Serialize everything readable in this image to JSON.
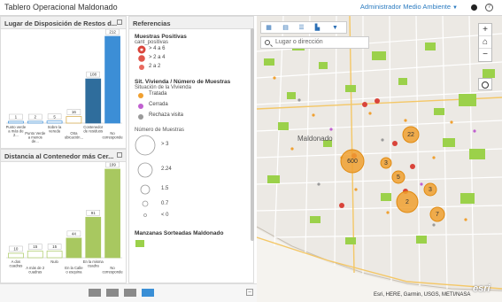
{
  "app": {
    "title": "Tablero Operacional Maldonado",
    "user": "Administrador Medio Ambiente"
  },
  "panel_lugar": {
    "title": "Lugar de Disposición de Restos d..."
  },
  "panel_distancia": {
    "title": "Distancia al Contenedor más Cer..."
  },
  "panel_ref": {
    "title": "Referencias",
    "muestras_title": "Muestras Positivas",
    "muestras_field": "cant_positivas",
    "muestras_items": [
      "> 4 a 6",
      "> 2 a 4",
      "2 a 2"
    ],
    "vivienda_title": "Sit. Vivienda / Número de Muestras",
    "vivienda_sub": "Situación de la Vivienda",
    "vivienda_items": [
      "Tratada",
      "Cerrada",
      "Rechaza visita"
    ],
    "numero_title": "Número de Muestras",
    "numero_items": [
      "> 3",
      "2.24",
      "1.5",
      "0.7",
      "< 0"
    ],
    "manzanas_title": "Manzanas Sorteadas Maldonado"
  },
  "map": {
    "search_placeholder": "Lugar o dirección",
    "attribution": "Esri, HERE, Garmin, USGS, METI/NASA",
    "logo": "esri",
    "city_label": "Maldonado",
    "cluster_labels": [
      "600",
      "22",
      "5",
      "2",
      "3",
      "7",
      "3"
    ]
  },
  "colors": {
    "bar_lugar": [
      "#3c8ed6",
      "#3c8ed6",
      "#3c8ed6",
      "#d4a640",
      "#2f6d9c",
      "#3c8ed6"
    ],
    "bar_distancia": "#a8c860",
    "accent": "#3a8fd6",
    "cluster": "#f0a030",
    "green_area": "#9bd14a"
  },
  "chart_data": [
    {
      "type": "bar",
      "categories": [
        "Punto verde a más de 2...",
        "Punto Verde a menos de...",
        "Sobre la vereda",
        "Otra ubicación...",
        "Contenedor de residuos",
        "No corresponde"
      ],
      "values": [
        1,
        2,
        5,
        16,
        108,
        212
      ],
      "ylim": [
        0,
        212
      ]
    },
    {
      "type": "bar",
      "categories": [
        "A dos cuadras",
        "A más de 2 cuadras",
        "Nulo",
        "En la Calle o esquina",
        "En la misma cuadra",
        "No corresponde"
      ],
      "values": [
        10,
        15,
        15,
        44,
        91,
        199
      ],
      "ylim": [
        0,
        199
      ]
    }
  ]
}
